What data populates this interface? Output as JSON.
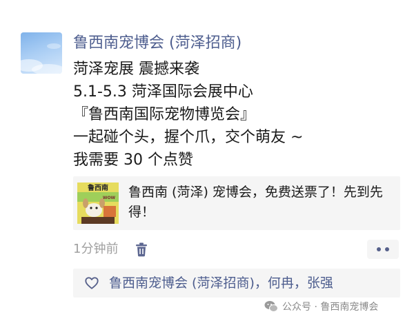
{
  "post": {
    "author": "鲁西南宠博会 (菏泽招商)",
    "lines": [
      "菏泽宠展 震撼来袭",
      "5.1-5.3 菏泽国际会展中心",
      "『鲁西南国际宠物博览会』",
      "一起碰个头，握个爪，交个萌友 ~",
      "我需要 30 个点赞"
    ],
    "link": {
      "title": "鲁西南 (菏泽) 宠博会，免费送票了！先到先得！",
      "thumbnail_text": "鲁西南",
      "thumbnail_badge": "WOW"
    },
    "time": "1分钟前",
    "likes": "鲁西南宠博会 (菏泽招商)，何冉，张强"
  },
  "watermark": "公众号 · 鲁西南宠博会",
  "icons": {
    "delete": "trash-icon",
    "more": "more-dots-icon",
    "like": "heart-outline-icon",
    "watermark": "wechat-icon"
  },
  "colors": {
    "name_link": "#4d5d8e",
    "text": "#1a1a1a",
    "muted": "#a0a0a0",
    "card_bg": "#f5f5f5"
  }
}
